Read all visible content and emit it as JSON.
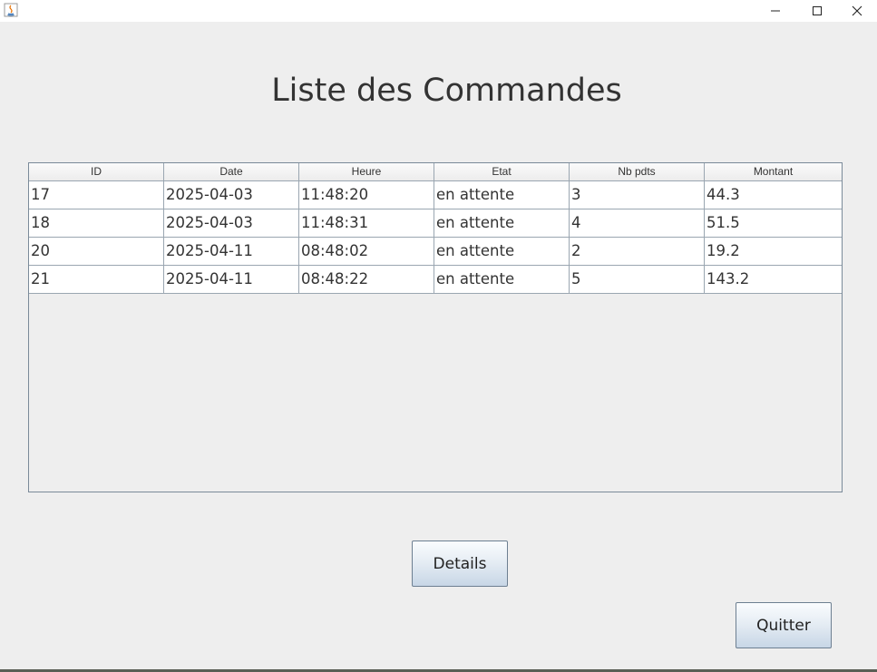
{
  "window": {
    "minimize_icon": "minimize-icon",
    "maximize_icon": "maximize-icon",
    "close_icon": "close-icon"
  },
  "page": {
    "title": "Liste des Commandes"
  },
  "table": {
    "columns": [
      "ID",
      "Date",
      "Heure",
      "Etat",
      "Nb pdts",
      "Montant"
    ],
    "rows": [
      [
        "17",
        "2025-04-03",
        "11:48:20",
        "en attente",
        "3",
        "44.3"
      ],
      [
        "18",
        "2025-04-03",
        "11:48:31",
        "en attente",
        "4",
        "51.5"
      ],
      [
        "20",
        "2025-04-11",
        "08:48:02",
        "en attente",
        "2",
        "19.2"
      ],
      [
        "21",
        "2025-04-11",
        "08:48:22",
        "en attente",
        "5",
        "143.2"
      ]
    ]
  },
  "buttons": {
    "details_label": "Details",
    "quit_label": "Quitter"
  }
}
